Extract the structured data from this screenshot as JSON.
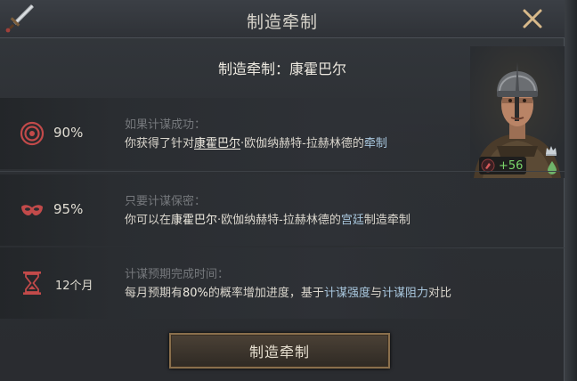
{
  "window": {
    "title": "制造牵制",
    "subtitle": "制造牵制：康霍巴尔"
  },
  "character": {
    "power_value": "+56"
  },
  "rows": [
    {
      "value": "90%",
      "heading": "如果计谋成功：",
      "text_parts": [
        "你获得了针对",
        "康霍巴尔",
        "·欧伽纳赫特-拉赫林德的",
        "牵制"
      ]
    },
    {
      "value": "95%",
      "heading": "只要计谋保密：",
      "text_parts": [
        "你可以在",
        "康霍巴尔",
        "·欧伽纳赫特-拉赫林德的",
        "宫廷",
        "制造牵制"
      ]
    },
    {
      "value": "12个月",
      "heading": "计谋预期完成时间：",
      "text_parts": [
        "每月预期有",
        "80%",
        "的概率增加进度，基于",
        "计谋强度",
        "与",
        "计谋阻力",
        "对比"
      ]
    }
  ],
  "footer": {
    "action_label": "制造牵制"
  },
  "colors": {
    "accent_red": "#c24a4a",
    "link_blue": "#a8c6dd",
    "power_green": "#7bd66a",
    "button_border": "#8a6f4c"
  },
  "icons": [
    "dagger-icon",
    "close-icon",
    "target-icon",
    "mask-icon",
    "hourglass-icon",
    "crown-icon",
    "water-drop-icon",
    "intrigue-power-icon"
  ]
}
